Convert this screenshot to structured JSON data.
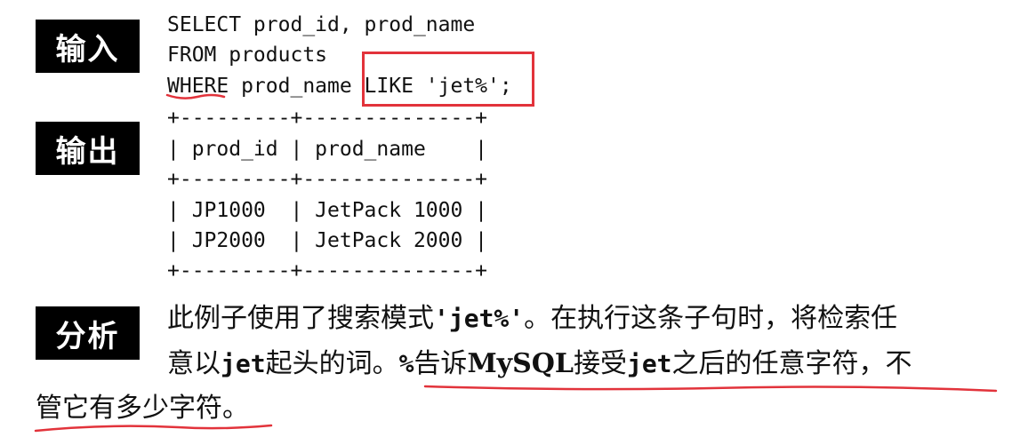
{
  "labels": {
    "input": "输入",
    "output": "输出",
    "analysis": "分析"
  },
  "sql": {
    "line1": "SELECT prod_id, prod_name",
    "line2": "FROM products",
    "line3": "WHERE prod_name LIKE 'jet%';"
  },
  "result_table": {
    "border": "+---------+--------------+",
    "header": "| prod_id | prod_name    |",
    "rows": [
      "| JP1000  | JetPack 1000 |",
      "| JP2000  | JetPack 2000 |"
    ]
  },
  "explanation": {
    "p1_a": "此例子使用了搜索模式",
    "p1_code": "'jet%'",
    "p1_b": "。在执行这条子句时，将检索任",
    "p2_a": "意以",
    "p2_code1": "jet",
    "p2_b": "起头的词。",
    "p2_code2": "%",
    "p2_c": "告诉",
    "p2_mysql": "MySQL",
    "p2_d": "接受",
    "p2_code3": "jet",
    "p2_e": "之后的任意字符，不",
    "p3": "管它有多少字符。"
  },
  "annotation_color": "#e2333b"
}
